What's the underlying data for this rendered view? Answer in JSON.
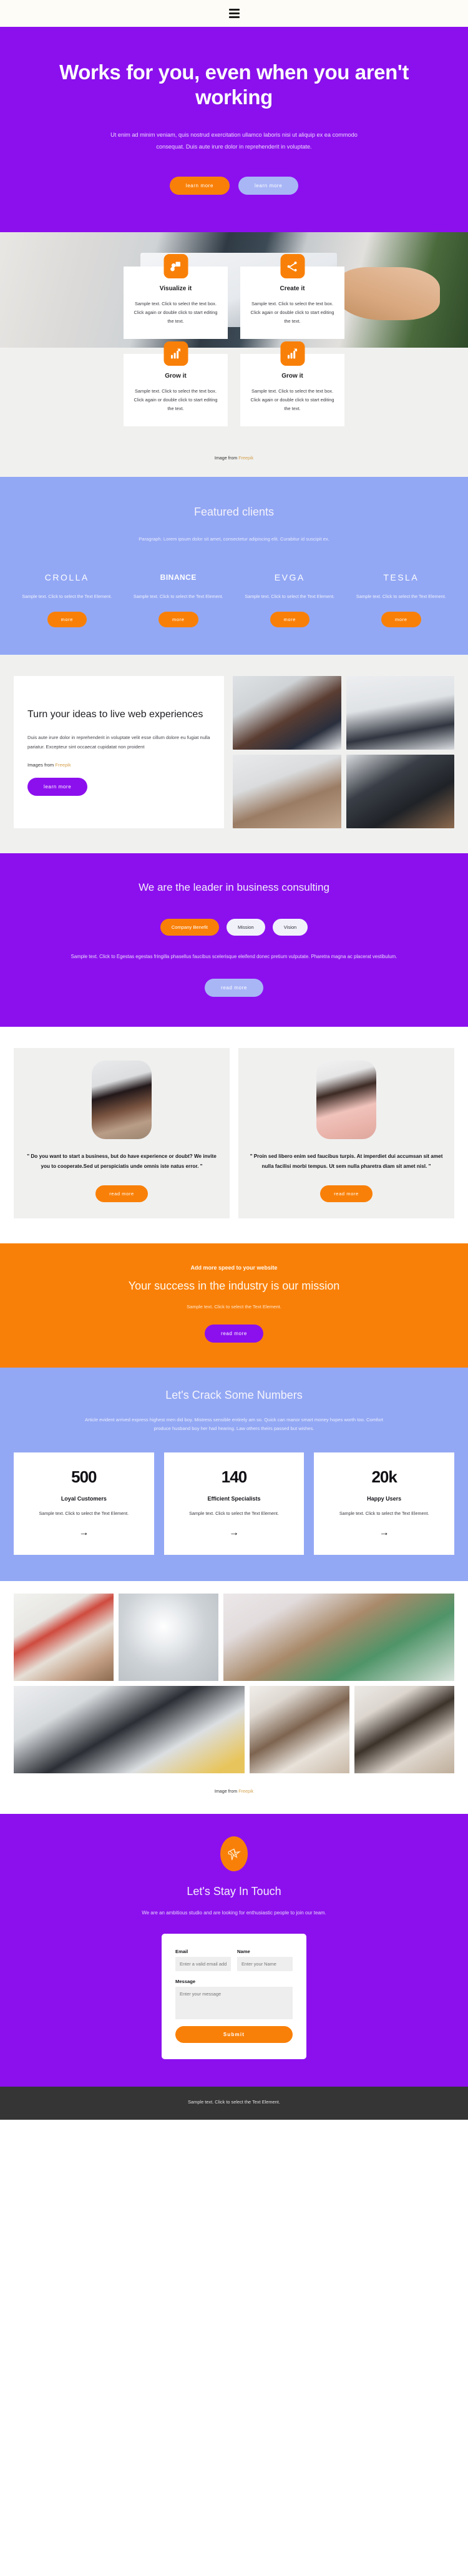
{
  "header": {
    "menu_icon": "hamburger-menu-icon"
  },
  "hero": {
    "title": "Works for you, even when you aren't working",
    "paragraph": "Ut enim ad minim veniam, quis nostrud exercitation ullamco laboris nisi ut aliquip ex ea commodo consequat. Duis aute irure dolor in reprehenderit in voluptate.",
    "primary_button": "learn more",
    "secondary_button": "learn more"
  },
  "features": {
    "credit_prefix": "Image from",
    "credit_link": "Freepik",
    "cards": [
      {
        "icon": "layers-icon",
        "title": "Visualize it",
        "text": "Sample text. Click to select the text box. Click again or double click to start editing the text."
      },
      {
        "icon": "share-nodes-icon",
        "title": "Create it",
        "text": "Sample text. Click to select the text box. Click again or double click to start editing the text."
      },
      {
        "icon": "bar-chart-up-icon",
        "title": "Grow it",
        "text": "Sample text. Click to select the text box. Click again or double click to start editing the text."
      },
      {
        "icon": "bar-chart-up-icon",
        "title": "Grow it",
        "text": "Sample text. Click to select the text box. Click again or double click to start editing the text."
      }
    ]
  },
  "clients": {
    "title": "Featured clients",
    "paragraph": "Paragraph. Lorem ipsum dolor sit amet, consectetur adipiscing elit. Curabitur id suscipit ex.",
    "items": [
      {
        "logo": "CROLLA",
        "note": "Sample text. Click to select the Text Element.",
        "button": "more"
      },
      {
        "logo": "BINANCE",
        "note": "Sample text. Click to select the Text Element.",
        "button": "more"
      },
      {
        "logo": "EVGA",
        "note": "Sample text. Click to select the Text Element.",
        "button": "more"
      },
      {
        "logo": "TESLA",
        "note": "Sample text. Click to select the Text Element.",
        "button": "more"
      }
    ]
  },
  "ideas": {
    "title": "Turn your ideas to live web experiences",
    "paragraph": "Duis aute irure dolor in reprehenderit in voluptate velit esse cillum dolore eu fugiat nulla pariatur. Excepteur sint occaecat cupidatat non proident",
    "credit_prefix": "Images from",
    "credit_link": "Freepik",
    "button": "learn more"
  },
  "leader": {
    "title": "We are the leader in business consulting",
    "tabs": [
      "Company Benefit",
      "Mission",
      "Vision"
    ],
    "active_tab": "Company Benefit",
    "paragraph": "Sample text. Click to Egestas egestas fringilla phasellus faucibus scelerisque eleifend donec pretium vulputate. Pharetra magna ac placerat vestibulum.",
    "button": "read more"
  },
  "testimonials": [
    {
      "avatar": "person-avatar",
      "quote": "\" Do you want to start a business, but do have experience or doubt? We invite you to cooperate.Sed ut perspiciatis unde omnis iste natus error. \"",
      "button": "read more"
    },
    {
      "avatar": "person-avatar",
      "quote": "\" Proin sed libero enim sed faucibus turpis. At imperdiet dui accumsan sit amet nulla facilisi morbi tempus. Ut sem nulla pharetra diam sit amet nisl. \"",
      "button": "read more"
    }
  ],
  "speed": {
    "kicker": "Add more speed to your website",
    "title": "Your success in the industry is our mission",
    "paragraph": "Sample text. Click to select the Text Element.",
    "button": "read more"
  },
  "numbers": {
    "title": "Let's Crack Some Numbers",
    "paragraph": "Article evident arrived express highest men did boy. Mistress sensible entirely am so. Quick can manor smart money hopes worth too. Comfort produce husband boy her had hearing. Law others theirs passed but wishes.",
    "cards": [
      {
        "value": "500",
        "label": "Loyal Customers",
        "note": "Sample text. Click to select the Text Element.",
        "icon": "arrow-right-icon"
      },
      {
        "value": "140",
        "label": "Efficient Specialists",
        "note": "Sample text. Click to select the Text Element.",
        "icon": "arrow-right-icon"
      },
      {
        "value": "20k",
        "label": "Happy Users",
        "note": "Sample text. Click to select the Text Element.",
        "icon": "arrow-right-icon"
      }
    ]
  },
  "gallery": {
    "credit_prefix": "Image from",
    "credit_link": "Freepik"
  },
  "contact": {
    "logo_icon": "origami-bird-icon",
    "title": "Let's Stay In Touch",
    "paragraph": "We are an ambitious studio and are looking for enthusiastic people to join our team.",
    "form": {
      "email_label": "Email",
      "email_placeholder": "Enter a valid email address",
      "name_label": "Name",
      "name_placeholder": "Enter your Name",
      "message_label": "Message",
      "message_placeholder": "Enter your message",
      "submit_label": "Submit"
    }
  },
  "footer": {
    "text": "Sample text. Click to select the Text Element."
  },
  "colors": {
    "purple": "#8c10ee",
    "orange": "#f98008",
    "periwinkle": "#93a8f4",
    "light_periwinkle": "#a8b6f6",
    "grey_bg": "#f0f0ef",
    "footer_bg": "#353535",
    "link_gold": "#d4a24e"
  }
}
